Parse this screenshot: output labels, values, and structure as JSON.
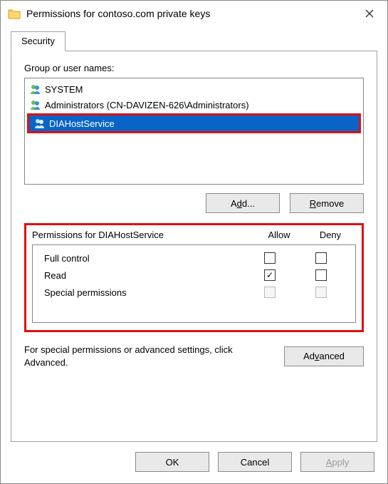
{
  "window": {
    "title": "Permissions for contoso.com private keys"
  },
  "tab": {
    "security": "Security"
  },
  "labels": {
    "groupUsers": "Group or user names:",
    "permsFor": "Permissions for DIAHostService",
    "allow": "Allow",
    "deny": "Deny",
    "advancedHint": "For special permissions or advanced settings, click Advanced."
  },
  "users": [
    {
      "name": "SYSTEM",
      "selected": false
    },
    {
      "name": "Administrators (CN-DAVIZEN-626\\Administrators)",
      "selected": false
    },
    {
      "name": "DIAHostService",
      "selected": true
    }
  ],
  "buttons": {
    "add": "Add...",
    "remove": "Remove",
    "advanced": "Advanced",
    "ok": "OK",
    "cancel": "Cancel",
    "apply": "Apply"
  },
  "permissions": [
    {
      "name": "Full control",
      "allow": false,
      "deny": false,
      "disabled": false
    },
    {
      "name": "Read",
      "allow": true,
      "deny": false,
      "disabled": false
    },
    {
      "name": "Special permissions",
      "allow": false,
      "deny": false,
      "disabled": true
    }
  ]
}
